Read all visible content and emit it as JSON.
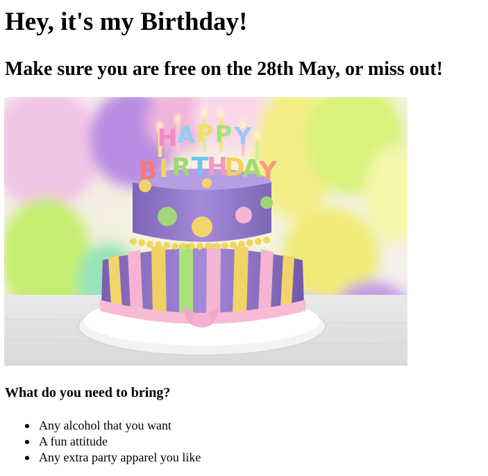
{
  "heading": "Hey, it's my Birthday!",
  "subheading": "Make sure you are free on the 28th May, or miss out!",
  "bring_heading": "What do you need to bring?",
  "bring_items": [
    "Any alcohol that you want",
    "A fun attitude",
    "Any extra party apparel you like"
  ],
  "image": {
    "subject": "birthday-cake-photo",
    "topper_letters_line1": [
      "H",
      "A",
      "P",
      "P",
      "Y"
    ],
    "topper_letters_line2": [
      "B",
      "I",
      "R",
      "T",
      "H",
      "D",
      "A",
      "Y"
    ]
  },
  "colors": {
    "text": "#000000",
    "background": "#ffffff",
    "cake_purple": "#9b7fd4",
    "balloon_yellow": "#f6f089",
    "balloon_green": "#c9ef7a",
    "ribbon_pink": "#f7bcd4"
  }
}
